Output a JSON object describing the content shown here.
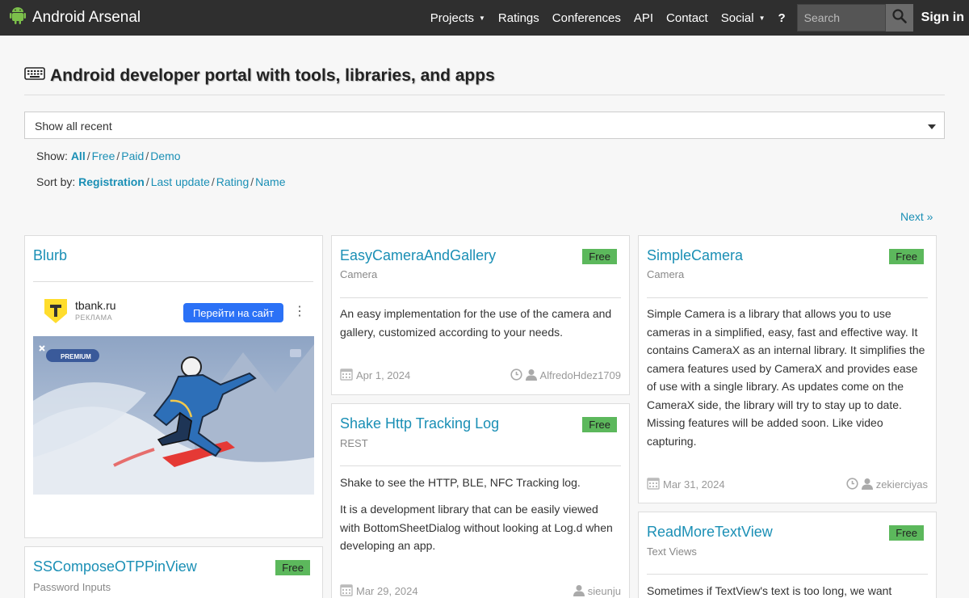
{
  "nav": {
    "brand": "Android Arsenal",
    "items": [
      "Projects",
      "Ratings",
      "Conferences",
      "API",
      "Contact",
      "Social"
    ],
    "help": "?",
    "search_placeholder": "Search",
    "signin": "Sign in"
  },
  "header": {
    "title": "Android developer portal with tools, libraries, and apps"
  },
  "filter": {
    "select_value": "Show all recent",
    "show_label": "Show:",
    "show_options": [
      "All",
      "Free",
      "Paid",
      "Demo"
    ],
    "sort_label": "Sort by:",
    "sort_options": [
      "Registration",
      "Last update",
      "Rating",
      "Name"
    ],
    "next": "Next »"
  },
  "cards": {
    "blurb": {
      "title": "Blurb",
      "ad_domain": "tbank.ru",
      "ad_label": "РЕКЛАМА",
      "ad_button": "Перейти на сайт",
      "ad_badge": "PREMIUM"
    },
    "easycamera": {
      "title": "EasyCameraAndGallery",
      "badge": "Free",
      "category": "Camera",
      "description": "An easy implementation for the use of the camera and gallery, customized according to your needs.",
      "date": "Apr 1, 2024",
      "user": "AlfredoHdez1709"
    },
    "shake": {
      "title": "Shake Http Tracking Log",
      "badge": "Free",
      "category": "REST",
      "description1": "Shake to see the HTTP, BLE, NFC Tracking log.",
      "description2": "It is a development library that can be easily viewed with BottomSheetDialog without looking at Log.d when developing an app.",
      "date": "Mar 29, 2024",
      "user": "sieunju"
    },
    "simplecamera": {
      "title": "SimpleCamera",
      "badge": "Free",
      "category": "Camera",
      "description": "Simple Camera is a library that allows you to use cameras in a simplified, easy, fast and effective way. It contains CameraX as an internal library. It simplifies the camera features used by CameraX and provides ease of use with a single library. As updates come on the CameraX side, the library will try to stay up to date. Missing features will be added soon. Like video capturing.",
      "date": "Mar 31, 2024",
      "user": "zekierciyas"
    },
    "readmore": {
      "title": "ReadMoreTextView",
      "badge": "Free",
      "category": "Text Views",
      "description": "Sometimes if TextView's text is too long, we want"
    },
    "sscompose": {
      "title": "SSComposeOTPPinView",
      "badge": "Free",
      "category": "Password Inputs"
    }
  },
  "colors": {
    "navbar": "#2f2f2f",
    "link": "#1a8fb5",
    "badge_green": "#5cb85c",
    "ad_button": "#2b71f6"
  }
}
